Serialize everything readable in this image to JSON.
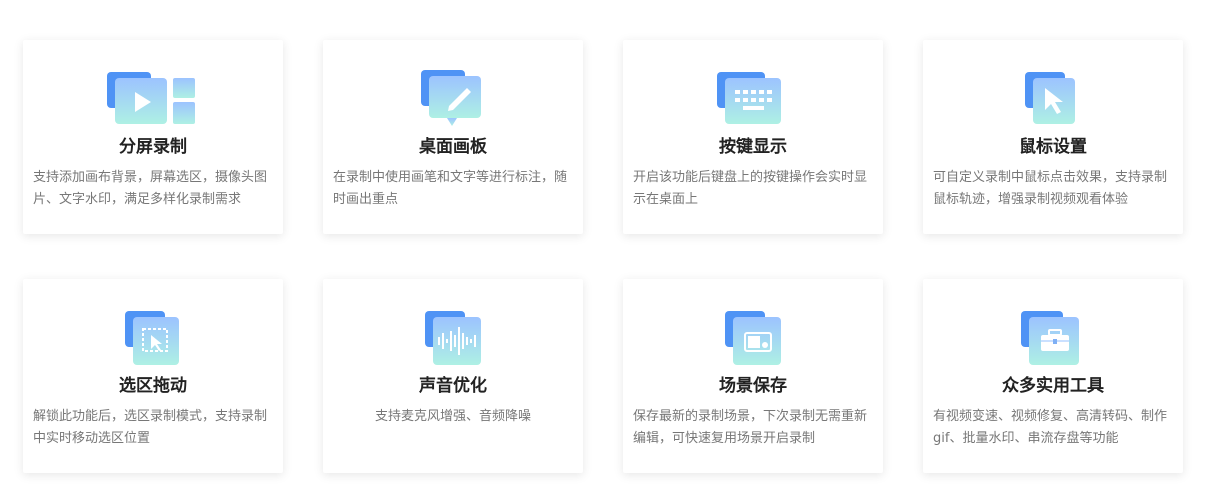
{
  "features": [
    {
      "title": "分屏录制",
      "desc": "支持添加画布背景，屏幕选区，摄像头图片、文字水印，满足多样化录制需求",
      "icon": "split-screen-icon"
    },
    {
      "title": "桌面画板",
      "desc": "在录制中使用画笔和文字等进行标注，随时画出重点",
      "icon": "pen-board-icon"
    },
    {
      "title": "按键显示",
      "desc": "开启该功能后键盘上的按键操作会实时显示在桌面上",
      "icon": "keyboard-icon"
    },
    {
      "title": "鼠标设置",
      "desc": "可自定义录制中鼠标点击效果，支持录制鼠标轨迹，增强录制视频观看体验",
      "icon": "mouse-cursor-icon"
    },
    {
      "title": "选区拖动",
      "desc": "解锁此功能后，选区录制模式，支持录制中实时移动选区位置",
      "icon": "region-drag-icon"
    },
    {
      "title": "声音优化",
      "desc": "支持麦克风增强、音频降噪",
      "icon": "sound-wave-icon"
    },
    {
      "title": "场景保存",
      "desc": "保存最新的录制场景，下次录制无需重新编辑，可快速复用场景开启录制",
      "icon": "scene-save-icon"
    },
    {
      "title": "众多实用工具",
      "desc": "有视频变速、视频修复、高清转码、制作gif、批量水印、串流存盘等功能",
      "icon": "toolbox-icon"
    }
  ],
  "colors": {
    "icon_back": "#4f93f5",
    "icon_front_top": "#8fb9ff",
    "icon_front_bottom": "#a9f0e2",
    "title": "#222222",
    "desc": "#777777"
  }
}
